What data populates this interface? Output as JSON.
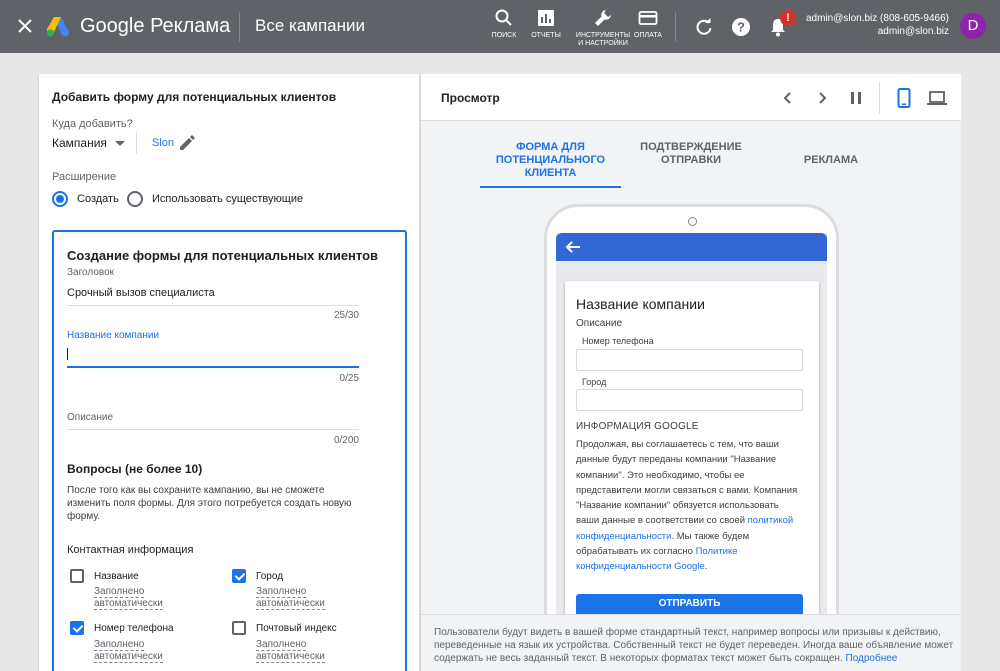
{
  "topbar": {
    "close_icon": "close-icon",
    "brand_google": "Google",
    "brand_product": "Реклама",
    "page_title": "Все кампании",
    "tools": [
      {
        "icon": "search-icon",
        "label": "ПОИСК"
      },
      {
        "icon": "reports-icon",
        "label": "ОТЧЕТЫ"
      },
      {
        "icon": "wrench-icon",
        "label": "ИНСТРУМЕНТЫ И НАСТРОЙКИ"
      },
      {
        "icon": "credit-card-icon",
        "label": "ОПЛАТА"
      }
    ],
    "badge": "!",
    "account_line1": "admin@slon.biz (808-605-9466)",
    "account_line2": "admin@slon.biz",
    "avatar_letter": "D",
    "avatar_color": "#8e24aa"
  },
  "left_panel": {
    "title": "Добавить форму для потенциальных клиентов",
    "where_label": "Куда добавить?",
    "where_value": "Кампания",
    "campaign_name": "Slon",
    "extension_label": "Расширение",
    "radio_create": "Создать",
    "radio_existing": "Использовать существующие",
    "card": {
      "title": "Создание формы для потенциальных клиентов",
      "headline_label": "Заголовок",
      "headline_value": "Срочный вызов специалиста",
      "headline_count": "25/30",
      "company_label": "Название компании",
      "company_value": "",
      "company_count": "0/25",
      "desc_label": "Описание",
      "desc_count": "0/200",
      "questions_title": "Вопросы (не более 10)",
      "questions_note": "После того как вы сохраните кампанию, вы не сможете изменить поля формы. Для этого потребуется создать новую форму.",
      "contact_title": "Контактная информация",
      "checkboxes": [
        {
          "label": "Название",
          "sub": "Заполнено автоматически",
          "checked": false
        },
        {
          "label": "Город",
          "sub": "Заполнено автоматически",
          "checked": true
        },
        {
          "label": "Номер телефона",
          "sub": "Заполнено автоматически",
          "checked": true
        },
        {
          "label": "Почтовый индекс",
          "sub": "Заполнено автоматически",
          "checked": false
        }
      ]
    }
  },
  "right_panel": {
    "title": "Просмотр",
    "tabs": [
      {
        "label": "ФОРМА ДЛЯ ПОТЕНЦИАЛЬНОГО КЛИЕНТА",
        "active": true
      },
      {
        "label": "ПОДТВЕРЖДЕНИЕ ОТПРАВКИ",
        "active": false
      },
      {
        "label": "РЕКЛАМА",
        "active": false
      }
    ],
    "preview": {
      "company_name": "Название компании",
      "description": "Описание",
      "field_phone": "Номер телефона",
      "field_city": "Город",
      "google_title": "ИНФОРМАЦИЯ GOOGLE",
      "google_text_1": "Продолжая, вы соглашаетесь с тем, что ваши данные будут переданы компании \"Название компании\". Это необходимо, чтобы ее представители могли связаться с вами. Компания \"Название компании\" обязуется использовать ваши данные в соответствии со своей ",
      "google_link_1": "политикой конфиденциальности",
      "google_text_2": ". Мы также будем обрабатывать их согласно ",
      "google_link_2": "Политике конфиденциальности Google",
      "google_text_3": ".",
      "submit_label": "ОТПРАВИТЬ"
    },
    "footer_text": "Пользователи будут видеть в вашей форме стандартный текст, например вопросы или призывы к действию, переведенные на язык их устройства. Собственный текст не будет переведен. Иногда ваше объявление может содержать не весь заданный текст. В некоторых форматах текст может быть сокращен. ",
    "footer_link": "Подробнее"
  },
  "colors": {
    "topbar": "#5f6368",
    "accent": "#1a73e8",
    "preview_header": "#3367d6",
    "badge": "#d93025"
  }
}
